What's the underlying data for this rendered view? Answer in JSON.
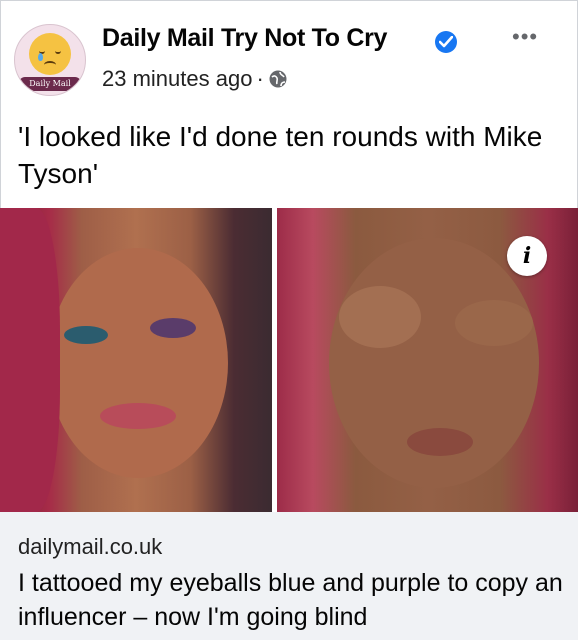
{
  "post": {
    "page_name": "Daily Mail Try Not To Cry",
    "timestamp": "23 minutes ago",
    "separator": "·",
    "audience_icon": "globe-icon",
    "verified_icon": "verified-badge-icon",
    "more_icon": "more-options-icon",
    "avatar_brand": "Daily Mail",
    "caption": "'I looked like I'd done ten rounds with Mike Tyson'",
    "info_icon": "i"
  },
  "link": {
    "domain": "dailymail.co.uk",
    "headline": "I tattooed my eyeballs blue and purple to copy an influencer – now I'm going blind"
  },
  "colors": {
    "verified": "#1877f2",
    "card_background": "#f0f2f5",
    "avatar_brand": "#6b2a4c"
  }
}
